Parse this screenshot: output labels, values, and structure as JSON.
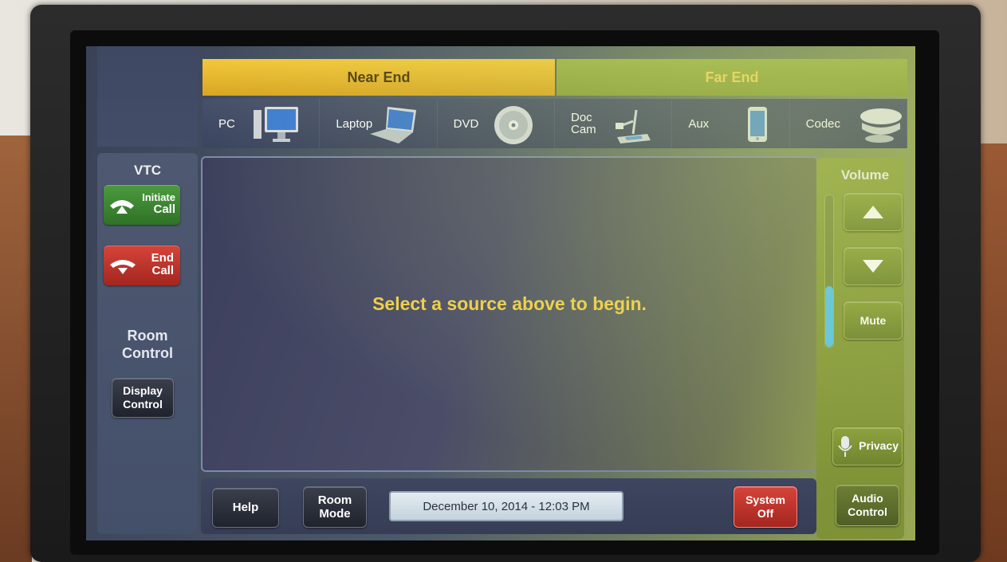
{
  "tabs": {
    "near_end": "Near End",
    "far_end": "Far End"
  },
  "sources": [
    {
      "label": "PC",
      "icon": "monitor-icon"
    },
    {
      "label": "Laptop",
      "icon": "laptop-icon"
    },
    {
      "label": "DVD",
      "icon": "disc-icon"
    },
    {
      "label": "Doc\nCam",
      "icon": "document-camera-icon"
    },
    {
      "label": "Aux",
      "icon": "phone-icon"
    },
    {
      "label": "Codec",
      "icon": "codec-icon"
    }
  ],
  "left": {
    "vtc_heading": "VTC",
    "initiate_line1": "Initiate",
    "initiate_line2": "Call",
    "end_line1": "End",
    "end_line2": "Call",
    "room_control_line1": "Room",
    "room_control_line2": "Control",
    "display_line1": "Display",
    "display_line2": "Control"
  },
  "main": {
    "message": "Select a source above to begin."
  },
  "right": {
    "volume_heading": "Volume",
    "volume_level_percent": 40,
    "mute_label": "Mute",
    "privacy_label": "Privacy",
    "audio_line1": "Audio",
    "audio_line2": "Control"
  },
  "bottom": {
    "help_label": "Help",
    "room_mode_line1": "Room",
    "room_mode_line2": "Mode",
    "datetime": "December 10, 2014  -  12:03 PM",
    "system_off_line1": "System",
    "system_off_line2": "Off"
  },
  "colors": {
    "tab_near": "#f3c83c",
    "tab_far": "#9fb34a",
    "message": "#f2cf46",
    "green": "#4c9a3e",
    "red": "#d5443a"
  }
}
